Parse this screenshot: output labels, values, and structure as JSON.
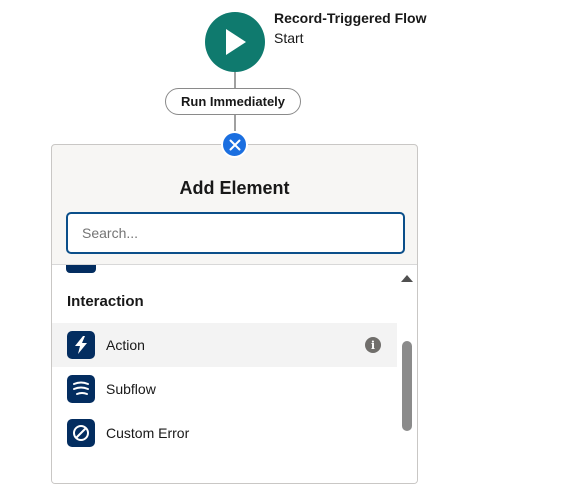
{
  "start": {
    "title": "Record-Triggered Flow",
    "subtitle": "Start"
  },
  "connector": {
    "label": "Run Immediately"
  },
  "panel": {
    "title": "Add Element",
    "search": {
      "placeholder": "Search...",
      "value": ""
    },
    "section": "Interaction",
    "items": [
      {
        "label": "Action",
        "icon": "lightning-icon"
      },
      {
        "label": "Subflow",
        "icon": "subflow-icon"
      },
      {
        "label": "Custom Error",
        "icon": "ban-icon"
      }
    ]
  },
  "colors": {
    "start_node": "#0f7a6e",
    "close_button": "#1b6fe0",
    "icon_tile": "#032d60",
    "search_border": "#0b4f8a"
  }
}
